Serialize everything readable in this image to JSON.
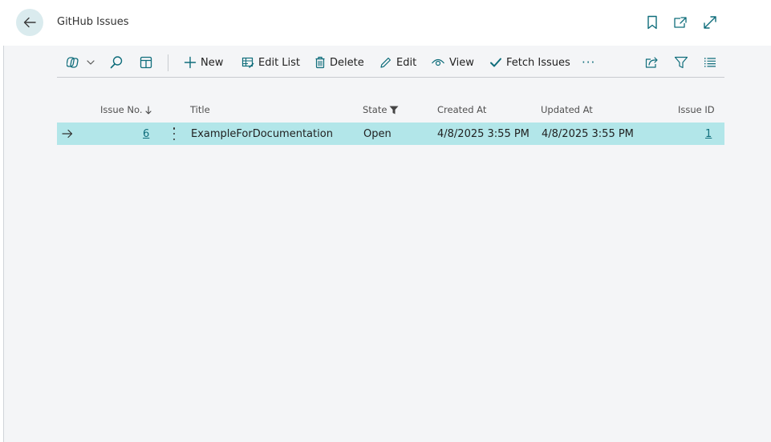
{
  "page": {
    "title": "GitHub Issues"
  },
  "actions": {
    "new": "New",
    "edit_list": "Edit List",
    "delete": "Delete",
    "edit": "Edit",
    "view": "View",
    "fetch_issues": "Fetch Issues",
    "more": "···"
  },
  "columns": {
    "issue_no": "Issue No.",
    "title": "Title",
    "state": "State",
    "created_at": "Created At",
    "updated_at": "Updated At",
    "issue_id": "Issue ID"
  },
  "rows": [
    {
      "issue_no": "6",
      "title": "ExampleForDocumentation",
      "state": "Open",
      "created_at": "4/8/2025 3:55 PM",
      "updated_at": "4/8/2025 3:55 PM",
      "issue_id": "1"
    }
  ],
  "icons": {
    "back": "arrow-left-icon",
    "bookmark": "bookmark-icon",
    "open_new_window": "open-in-new-window-icon",
    "expand": "expand-icon",
    "copilot": "copilot-icon",
    "search": "search-icon",
    "layout": "layout-icon",
    "share": "share-icon",
    "filter": "filter-icon",
    "list_view": "list-view-icon"
  },
  "colors": {
    "accent": "#0f6d7b",
    "selected_row": "#b2e6e9",
    "back_button_bg": "#daebee",
    "page_bg": "#f4f5f7"
  }
}
